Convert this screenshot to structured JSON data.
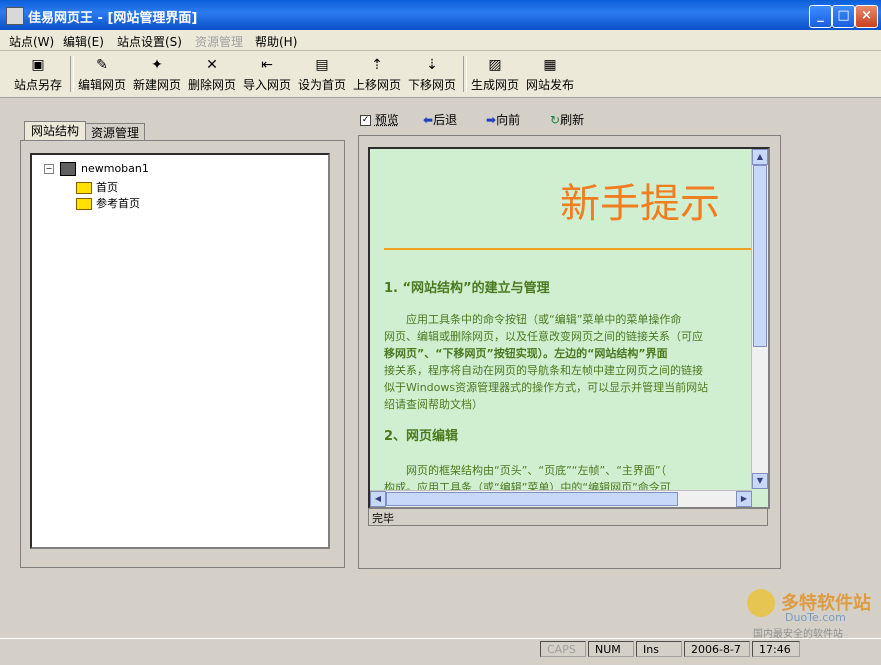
{
  "window": {
    "title": "佳易网页王 - [网站管理界面]"
  },
  "menu": [
    "站点(W)",
    "编辑(E)",
    "站点设置(S)",
    "资源管理",
    "帮助(H)"
  ],
  "toolbar": {
    "buttons": [
      "站点另存",
      "编辑网页",
      "新建网页",
      "删除网页",
      "导入网页",
      "设为首页",
      "上移网页",
      "下移网页",
      "生成网页",
      "网站发布"
    ]
  },
  "left": {
    "tabs": [
      "网站结构",
      "资源管理"
    ],
    "tree": {
      "root": "newmoban1",
      "children": [
        "首页",
        "参考首页"
      ]
    }
  },
  "nav": {
    "preview": "预览",
    "back": "后退",
    "forward": "向前",
    "refresh": "刷新"
  },
  "viewer": {
    "title": "新手提示",
    "heading1": "1. “网站结构”的建立与管理",
    "para1": [
      "　　应用工具条中的命令按钮（或“编辑”菜单中的菜单操作命",
      "网页、编辑或删除网页，以及任意改变网页之间的链接关系（可应",
      "移网页”、“下移网页”按钮实现）。左边的“网站结构”界面",
      "接关系，程序将自动在网页的导航条和左帧中建立网页之间的链接",
      "似于Windows资源管理器式的操作方式，可以显示并管理当前网站",
      "绍请查阅帮助文档）"
    ],
    "heading2": "2、网页编辑",
    "para2": [
      "　　网页的框架结构由“页头”、“页底”“左帧”、“主界面”（",
      "构成。应用工具条（或“编辑”菜单）中的“编辑网页”命令可"
    ],
    "status": "完毕"
  },
  "statusbar": {
    "caps": "CAPS",
    "num": "NUM",
    "ins": "Ins",
    "date": "2006-8-7",
    "time": "17:46"
  },
  "watermark": {
    "line1": "多特软件站",
    "line2": "DuoTe.com",
    "line3": "国内最安全的软件站"
  }
}
